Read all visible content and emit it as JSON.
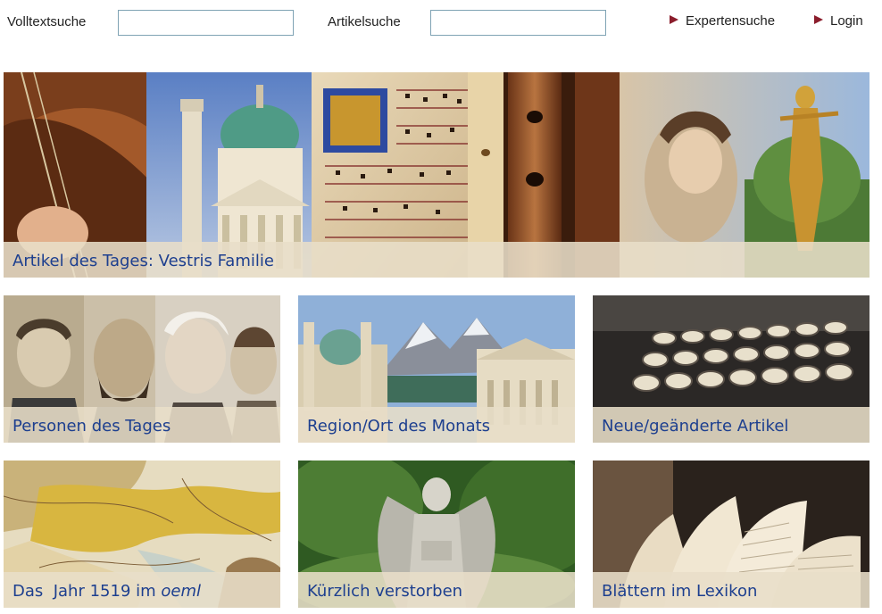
{
  "search": {
    "fulltext_label": "Volltextsuche",
    "fulltext_value": "",
    "article_label": "Artikelsuche",
    "article_value": ""
  },
  "nav": {
    "expert_search": "Expertensuche",
    "login": "Login"
  },
  "hero": {
    "caption": "Artikel des Tages: Vestris Familie"
  },
  "tiles": [
    {
      "caption": "Personen des Tages"
    },
    {
      "caption": "Region/Ort des Monats"
    },
    {
      "caption": "Neue/geänderte Artikel"
    },
    {
      "caption_prefix": "Das  Jahr 1519 im ",
      "caption_emph": "oeml"
    },
    {
      "caption": "Kürzlich verstorben"
    },
    {
      "caption": "Blättern im Lexikon"
    }
  ],
  "colors": {
    "link_blue": "#1d3f8f",
    "arrow_red": "#8b1d2c",
    "caption_band": "#e8dec8"
  }
}
